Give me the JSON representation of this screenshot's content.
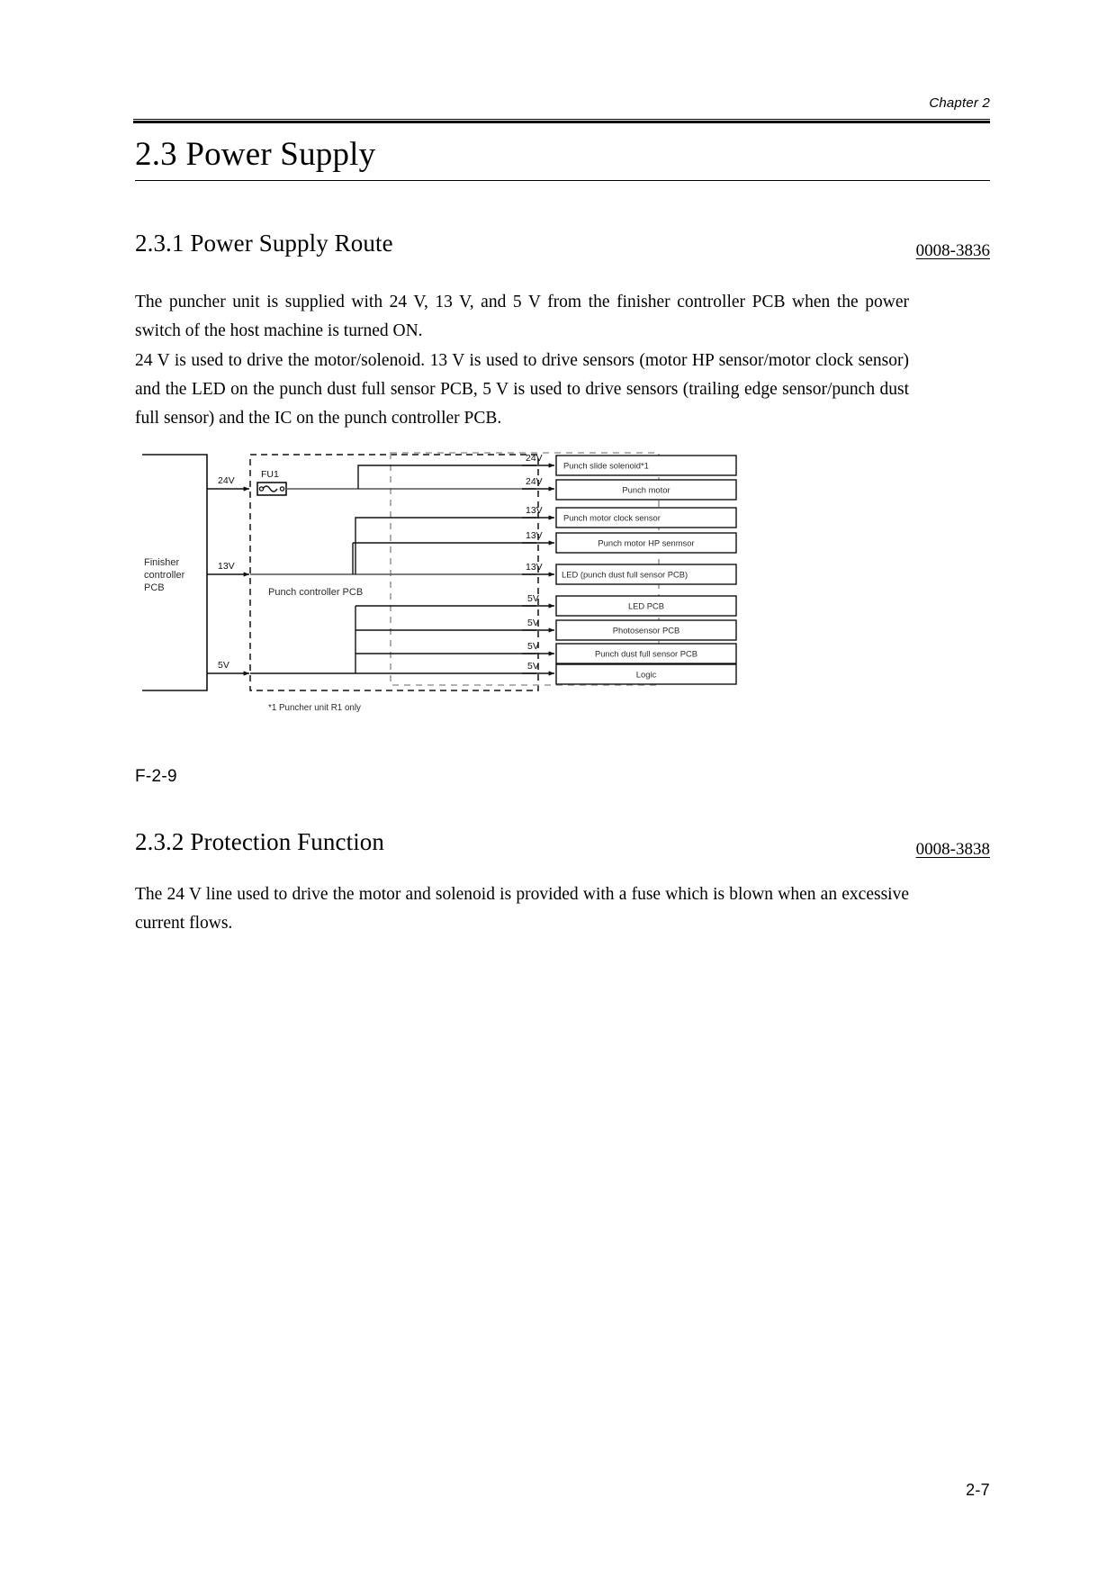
{
  "header": {
    "chapter_label": "Chapter 2"
  },
  "title": {
    "number": "2.3",
    "text": "Power Supply"
  },
  "sections": [
    {
      "number": "2.3.1",
      "heading": "Power Supply Route",
      "doc_code": "0008-3836",
      "paragraphs": [
        "The puncher unit is supplied with 24 V, 13 V, and 5 V from the finisher controller PCB when the power switch of the host machine is turned ON.",
        "24 V is used to drive the motor/solenoid. 13 V is used to drive sensors (motor HP sensor/motor clock sensor) and the LED on the punch dust full sensor PCB, 5 V is used to drive sensors (trailing edge sensor/punch dust full sensor) and the IC on the punch controller PCB."
      ]
    },
    {
      "number": "2.3.2",
      "heading": "Protection Function",
      "doc_code": "0008-3838",
      "paragraphs": [
        "The 24 V line used to drive the motor and solenoid is provided with a fuse which is blown when an excessive current flows."
      ]
    }
  ],
  "figure": {
    "label": "F-2-9",
    "source_block": "Finisher\ncontroller\nPCB",
    "source_block_lines": [
      "Finisher",
      "controller",
      "PCB"
    ],
    "fuse_label": "FU1",
    "controller_label": "Punch controller PCB",
    "footnote": "*1 Puncher unit R1 only",
    "rails": [
      {
        "voltage": "24V"
      },
      {
        "voltage": "13V"
      },
      {
        "voltage": "5V"
      }
    ],
    "loads": [
      {
        "voltage": "24V",
        "label": "Punch slide solenoid*1"
      },
      {
        "voltage": "24V",
        "label": "Punch motor"
      },
      {
        "voltage": "13V",
        "label": "Punch motor clock sensor"
      },
      {
        "voltage": "13V",
        "label": "Punch motor HP senmsor"
      },
      {
        "voltage": "13V",
        "label": "LED (punch dust full sensor PCB)"
      },
      {
        "voltage": "5V",
        "label": "LED PCB"
      },
      {
        "voltage": "5V",
        "label": "Photosensor PCB"
      },
      {
        "voltage": "5V",
        "label": "Punch dust full sensor PCB"
      },
      {
        "voltage": "5V",
        "label": "Logic"
      }
    ]
  },
  "footer": {
    "page_number": "2-7"
  }
}
